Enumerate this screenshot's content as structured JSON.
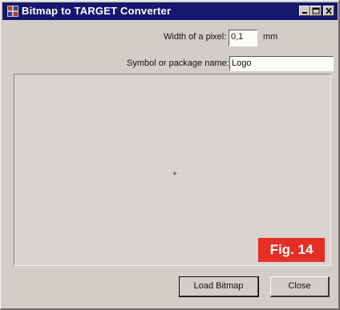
{
  "window": {
    "title": "Bitmap to TARGET Converter",
    "title_bar_color": "#16186f",
    "icon": "app-icon"
  },
  "caption_buttons": {
    "minimize": "minimize-icon",
    "maximize": "maximize-icon",
    "close": "close-icon"
  },
  "form": {
    "pixel_width_label": "Width of a pixel:",
    "pixel_width_value": "0,1",
    "pixel_width_unit": "mm",
    "symbol_name_label": "Symbol or package name:",
    "symbol_name_value": "Logo"
  },
  "preview": {
    "cursor": "+"
  },
  "figure_label": {
    "text": "Fig. 14",
    "color": "#e52f25"
  },
  "buttons": {
    "load_bitmap": "Load Bitmap",
    "close": "Close"
  }
}
